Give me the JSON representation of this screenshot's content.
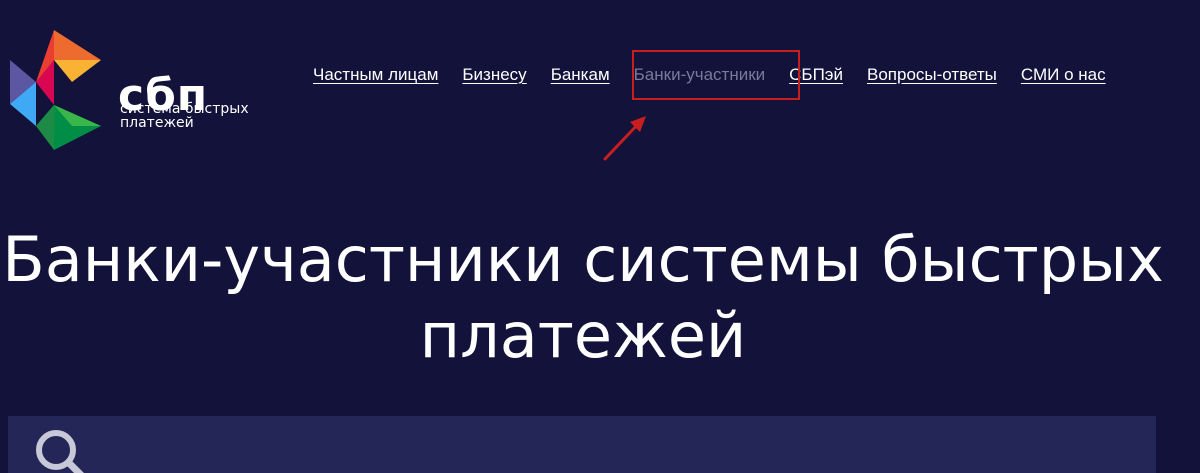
{
  "logo": {
    "wordmark": "сбп",
    "subtitle_line1": "система быстрых",
    "subtitle_line2": "платежей"
  },
  "nav": {
    "items": [
      {
        "label": "Частным лицам"
      },
      {
        "label": "Бизнесу"
      },
      {
        "label": "Банкам"
      },
      {
        "label": "Банки-участники",
        "active": true
      },
      {
        "label": "СБПэй"
      },
      {
        "label": "Вопросы-ответы"
      },
      {
        "label": "СМИ о нас"
      }
    ]
  },
  "page": {
    "title_line1": "Банки-участники системы быстрых",
    "title_line2": "платежей"
  },
  "search": {
    "icon": "search-icon",
    "placeholder": ""
  },
  "annotation": {
    "box_color": "#c81e1e",
    "arrow_color": "#c81e1e"
  },
  "colors": {
    "background": "#13123a",
    "search_bar": "#242657",
    "active_nav": "#7a7a98"
  }
}
